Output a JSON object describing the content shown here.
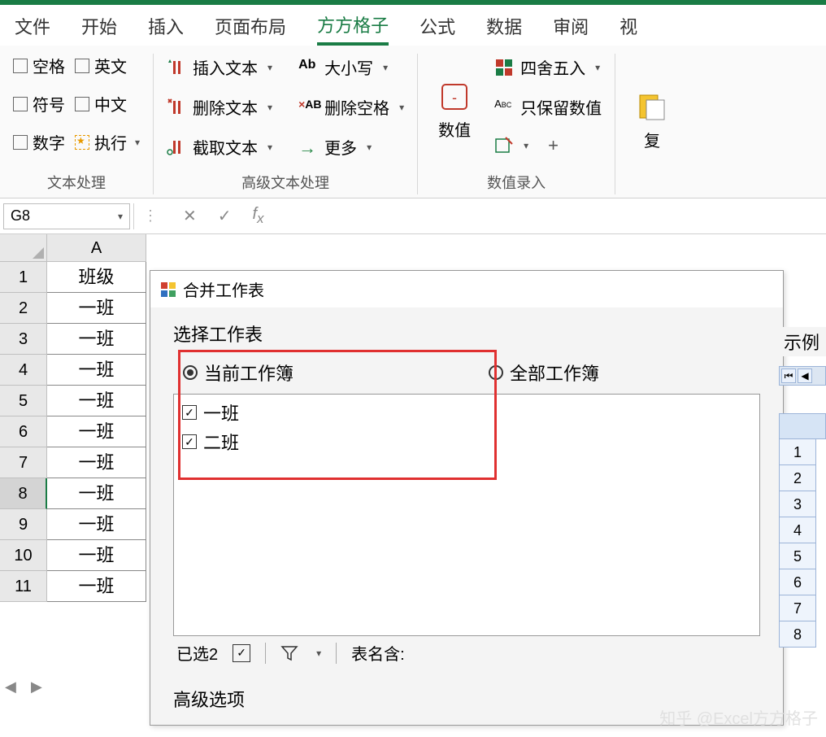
{
  "menu": {
    "tabs": [
      "文件",
      "开始",
      "插入",
      "页面布局",
      "方方格子",
      "公式",
      "数据",
      "审阅",
      "视"
    ],
    "active_index": 4
  },
  "ribbon": {
    "group1": {
      "label": "文本处理",
      "checks": {
        "c0": "空格",
        "c1": "英文",
        "c2": "符号",
        "c3": "中文",
        "c4": "数字",
        "c5": "执行"
      }
    },
    "group2": {
      "label": "高级文本处理",
      "b0": "插入文本",
      "b1": "删除文本",
      "b2": "截取文本",
      "b3": "大小写",
      "b4": "删除空格",
      "b5": "更多"
    },
    "group3": {
      "label": "数值录入",
      "big": "数值",
      "b0": "四舍五入",
      "b1": "只保留数值"
    },
    "group4_big": "复"
  },
  "namebox": {
    "value": "G8"
  },
  "grid": {
    "col_header": "A",
    "rows": [
      {
        "n": "1",
        "v": "班级"
      },
      {
        "n": "2",
        "v": "一班"
      },
      {
        "n": "3",
        "v": "一班"
      },
      {
        "n": "4",
        "v": "一班"
      },
      {
        "n": "5",
        "v": "一班"
      },
      {
        "n": "6",
        "v": "一班"
      },
      {
        "n": "7",
        "v": "一班"
      },
      {
        "n": "8",
        "v": "一班"
      },
      {
        "n": "9",
        "v": "一班"
      },
      {
        "n": "10",
        "v": "一班"
      },
      {
        "n": "11",
        "v": "一班"
      }
    ],
    "selected_row": "8"
  },
  "dialog": {
    "title": "合并工作表",
    "section": "选择工作表",
    "radio_current": "当前工作簿",
    "radio_all": "全部工作簿",
    "sheets": [
      "一班",
      "二班"
    ],
    "status_count": "已选2",
    "tablename_label": "表名含:",
    "advanced": "高级选项"
  },
  "example": {
    "label": "示例",
    "rows": [
      "1",
      "2",
      "3",
      "4",
      "5",
      "6",
      "7",
      "8"
    ]
  },
  "watermark": "知乎 @Excel方方格子"
}
